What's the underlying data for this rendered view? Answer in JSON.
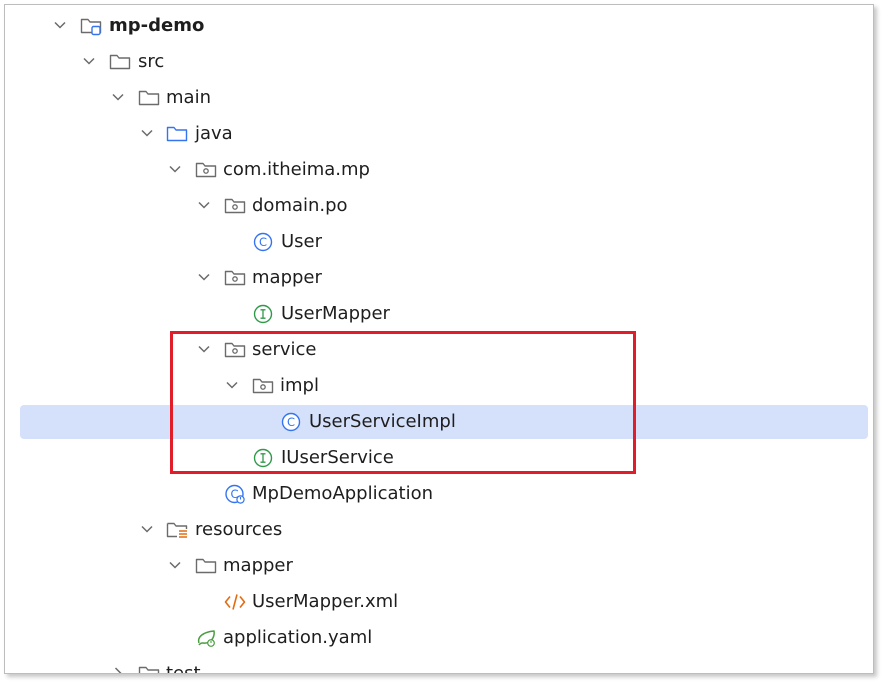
{
  "tree": {
    "items": [
      {
        "label": "mp-demo",
        "icon": "module-folder-icon",
        "expanded": true,
        "bold": true
      },
      {
        "label": "src",
        "icon": "folder-icon",
        "expanded": true
      },
      {
        "label": "main",
        "icon": "folder-icon",
        "expanded": true
      },
      {
        "label": "java",
        "icon": "source-folder-icon",
        "expanded": true
      },
      {
        "label": "com.itheima.mp",
        "icon": "package-icon",
        "expanded": true
      },
      {
        "label": "domain.po",
        "icon": "package-icon",
        "expanded": true
      },
      {
        "label": "User",
        "icon": "class-icon"
      },
      {
        "label": "mapper",
        "icon": "package-icon",
        "expanded": true
      },
      {
        "label": "UserMapper",
        "icon": "interface-icon"
      },
      {
        "label": "service",
        "icon": "package-icon",
        "expanded": true
      },
      {
        "label": "impl",
        "icon": "package-icon",
        "expanded": true
      },
      {
        "label": "UserServiceImpl",
        "icon": "class-icon",
        "selected": true
      },
      {
        "label": "IUserService",
        "icon": "interface-icon"
      },
      {
        "label": "MpDemoApplication",
        "icon": "spring-boot-class-icon"
      },
      {
        "label": "resources",
        "icon": "resources-folder-icon",
        "expanded": true
      },
      {
        "label": "mapper",
        "icon": "folder-icon",
        "expanded": true
      },
      {
        "label": "UserMapper.xml",
        "icon": "xml-file-icon"
      },
      {
        "label": "application.yaml",
        "icon": "spring-yaml-icon"
      },
      {
        "label": "test",
        "icon": "folder-icon",
        "expanded": false
      }
    ]
  },
  "colors": {
    "selection": "#d5e1fb",
    "highlight_border": "#e11d2a",
    "class_icon": "#3574f0",
    "interface_icon": "#2f9a4a",
    "xml_icon": "#e36b12",
    "spring_icon": "#4a9e3f"
  }
}
